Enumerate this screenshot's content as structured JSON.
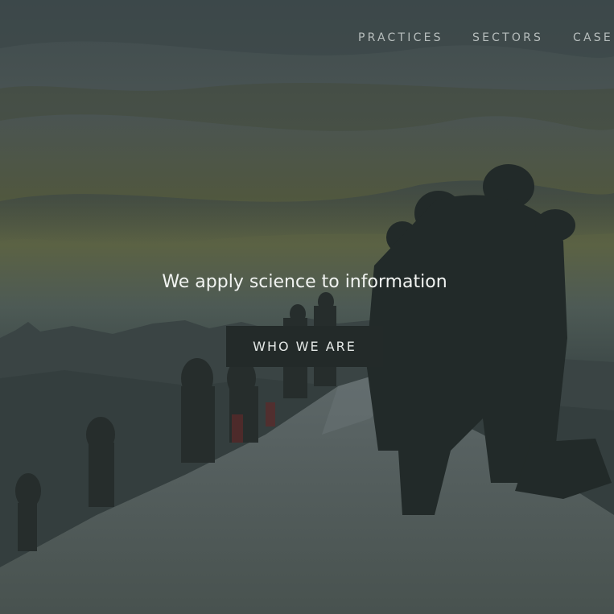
{
  "nav": {
    "items": [
      {
        "label": "PRACTICES"
      },
      {
        "label": "SECTORS"
      },
      {
        "label": "CASE"
      }
    ]
  },
  "hero": {
    "tagline": "We apply science to information",
    "cta_label": "WHO WE ARE",
    "background": "mountain-summit-climbers-photo"
  },
  "colors": {
    "nav_text": "#b7bebd",
    "tagline_text": "#f1f3f1",
    "button_bg": "#232a29",
    "button_text": "#e4e8e6"
  }
}
